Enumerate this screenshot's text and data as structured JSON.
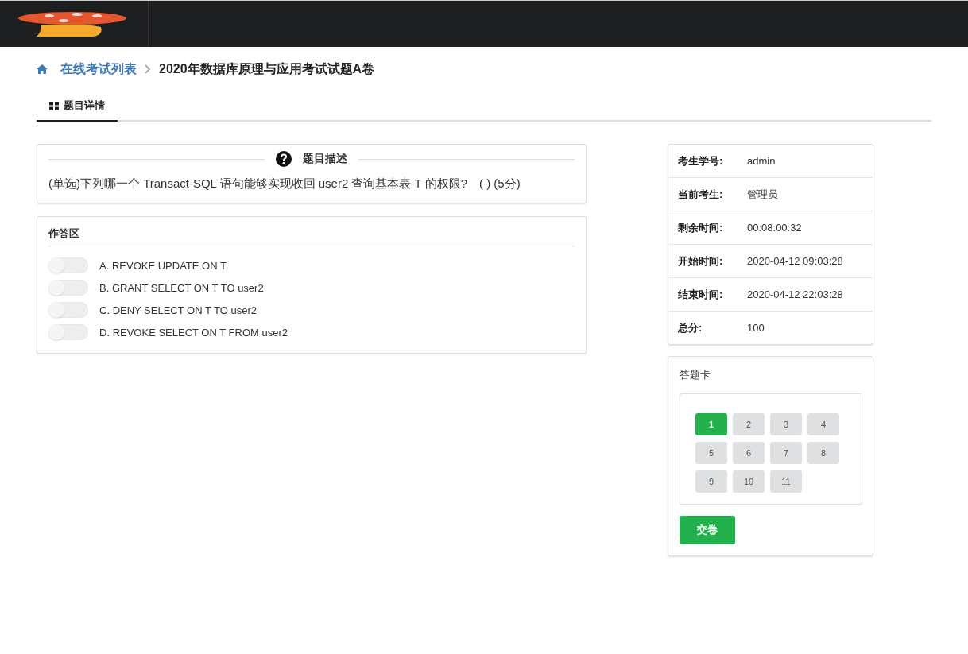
{
  "breadcrumb": {
    "link": "在线考试列表",
    "current": "2020年数据库原理与应用考试试题A卷"
  },
  "tabs": [
    {
      "label": "题目详情",
      "selected": true
    }
  ],
  "question": {
    "heading": "题目描述",
    "text": "(单选)下列哪一个 Transact-SQL 语句能够实现收回 user2 查询基本表 T 的权限?　( ) (5分)"
  },
  "answer_area": {
    "title": "作答区",
    "options": [
      {
        "letter": "A.",
        "text": "REVOKE UPDATE ON T",
        "checked": false
      },
      {
        "letter": "B.",
        "text": "GRANT SELECT ON T TO user2",
        "checked": false
      },
      {
        "letter": "C.",
        "text": "DENY SELECT ON T TO user2",
        "checked": false
      },
      {
        "letter": "D.",
        "text": "REVOKE SELECT ON T FROM user2",
        "checked": false
      }
    ]
  },
  "info": [
    {
      "label": "考生学号:",
      "value": "admin"
    },
    {
      "label": "当前考生:",
      "value": "管理员"
    },
    {
      "label": "剩余时间:",
      "value": "00:08:00:32"
    },
    {
      "label": "开始时间:",
      "value": "2020-04-12 09:03:28"
    },
    {
      "label": "结束时间:",
      "value": "2020-04-12 22:03:28"
    },
    {
      "label": "总分:",
      "value": "100"
    }
  ],
  "answer_card": {
    "title": "答题卡",
    "items": [
      {
        "label": "1",
        "selected": true
      },
      {
        "label": "2",
        "selected": false
      },
      {
        "label": "3",
        "selected": false
      },
      {
        "label": "4",
        "selected": false
      },
      {
        "label": "5",
        "selected": false
      },
      {
        "label": "6",
        "selected": false
      },
      {
        "label": "7",
        "selected": false
      },
      {
        "label": "8",
        "selected": false
      },
      {
        "label": "9",
        "selected": false
      },
      {
        "label": "10",
        "selected": false
      },
      {
        "label": "11",
        "selected": false
      }
    ],
    "submit": "交卷"
  }
}
